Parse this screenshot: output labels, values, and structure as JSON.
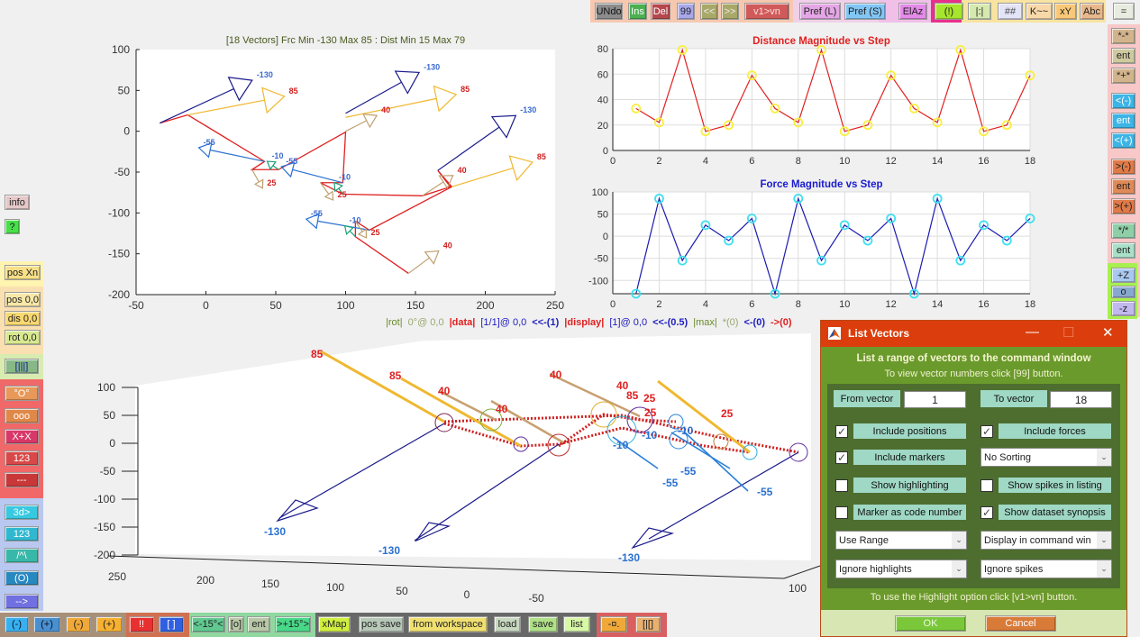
{
  "top_toolbar": {
    "buttons": [
      {
        "label": "UNdo",
        "bg": "#8c8c8c",
        "color": "#111"
      },
      {
        "label": "Ins",
        "bg": "#4caf50",
        "color": "#fff"
      },
      {
        "label": "Del",
        "bg": "#b5474d",
        "color": "#fff"
      },
      {
        "label": "99",
        "bg": "#a8a8e8",
        "color": "#223"
      },
      {
        "label": "<<",
        "bg": "#a8a868",
        "color": "#eee"
      },
      {
        "label": ">>",
        "bg": "#a8a868",
        "color": "#eee"
      },
      {
        "label": "v1>vn",
        "bg": "#d05a5a",
        "color": "#fdd"
      },
      {
        "label": "Pref (L)",
        "bg": "#e4a6e6",
        "color": "#222"
      },
      {
        "label": "Pref (S)",
        "bg": "#82c6f5",
        "color": "#222"
      },
      {
        "label": "ElAz",
        "bg": "#e48ae8",
        "color": "#222"
      },
      {
        "label": "(!)",
        "bg": "#a6e62c",
        "color": "#222"
      },
      {
        "label": "|:|",
        "bg": "#d6eab0",
        "color": "#222"
      },
      {
        "label": "##",
        "bg": "#e4e4f8",
        "color": "#444"
      },
      {
        "label": "K~~",
        "bg": "#f8d8a8",
        "color": "#222"
      },
      {
        "label": "xY",
        "bg": "#f8c878",
        "color": "#222"
      },
      {
        "label": "Abc",
        "bg": "#e8b88c",
        "color": "#222"
      },
      {
        "label": "=",
        "bg": "#e8ece0",
        "color": "#222"
      }
    ]
  },
  "right_toolbar": {
    "buttons": [
      {
        "label": "*-*",
        "bg": "#d2b48c"
      },
      {
        "label": "ent",
        "bg": "#cfc9a0"
      },
      {
        "label": "*+*",
        "bg": "#d2b48c"
      },
      {
        "label": "<(-)",
        "bg": "#3cb4e6"
      },
      {
        "label": "ent",
        "bg": "#3cb4e6"
      },
      {
        "label": "<(+)",
        "bg": "#3cb4e6"
      },
      {
        "label": ">(-)",
        "bg": "#e07a48"
      },
      {
        "label": "ent",
        "bg": "#e08a58"
      },
      {
        "label": ">(+)",
        "bg": "#e07a48"
      },
      {
        "label": "*/*",
        "bg": "#8fcfa8"
      },
      {
        "label": "ent",
        "bg": "#a8e0c8"
      },
      {
        "label": "+Z",
        "bg": "#a8c8f0"
      },
      {
        "label": "o",
        "bg": "#88a8d0"
      },
      {
        "label": "-z",
        "bg": "#c0b8ee"
      }
    ]
  },
  "left_toolbar": {
    "buttons": [
      {
        "label": "info",
        "bg": "#e6c8c8"
      },
      {
        "label": "?",
        "bg": "#48e048"
      },
      {
        "label": "pos Xn",
        "bg": "#f8e088"
      },
      {
        "label": "pos 0,0",
        "bg": "#f8e8a8"
      },
      {
        "label": "dis 0,0",
        "bg": "#f8d870"
      },
      {
        "label": "rot 0,0",
        "bg": "#d8e890"
      },
      {
        "label": "[|||]",
        "bg": "#88b888"
      },
      {
        "label": "°O°",
        "bg": "#e89858"
      },
      {
        "label": "ooo",
        "bg": "#e08848"
      },
      {
        "label": "X+X",
        "bg": "#d83868"
      },
      {
        "label": "123",
        "bg": "#d84848"
      },
      {
        "label": "---",
        "bg": "#c83838"
      },
      {
        "label": "3d>",
        "bg": "#38c8e0"
      },
      {
        "label": "123",
        "bg": "#30b8d0"
      },
      {
        "label": "/^\\",
        "bg": "#38b8a8"
      },
      {
        "label": "(O)",
        "bg": "#2888c0"
      },
      {
        "label": "-->",
        "bg": "#7070e0"
      }
    ]
  },
  "bottom_toolbar": {
    "buttons": [
      {
        "label": "(-)",
        "bg": "#38b0f0"
      },
      {
        "label": "(+)",
        "bg": "#4890d0"
      },
      {
        "label": "(-)",
        "bg": "#f0a838"
      },
      {
        "label": "(+)",
        "bg": "#f8b030"
      },
      {
        "label": "!!",
        "bg": "#e83030"
      },
      {
        "label": "[ ]",
        "bg": "#3060e0"
      },
      {
        "label": "<-15°<",
        "bg": "#60c890"
      },
      {
        "label": "[o]",
        "bg": "#b8c8a8"
      },
      {
        "label": "ent",
        "bg": "#b8c8a8"
      },
      {
        "label": ">+15°>",
        "bg": "#48d888"
      },
      {
        "label": "xMap",
        "bg": "#d0f040"
      },
      {
        "label": "pos save",
        "bg": "#b8c8b8"
      },
      {
        "label": "from workspace",
        "bg": "#f0e070"
      },
      {
        "label": "load",
        "bg": "#c8d8c0"
      },
      {
        "label": "save",
        "bg": "#b0e088"
      },
      {
        "label": "list",
        "bg": "#d8f8a8"
      },
      {
        "label": "-¤.",
        "bg": "#f0a838"
      },
      {
        "label": "[|[]",
        "bg": "#e8b070"
      }
    ]
  },
  "status_line": [
    {
      "text": "|rot|",
      "color": "#6a8a2a",
      "bold": false
    },
    {
      "text": "0°@ 0,0",
      "color": "#9aa870",
      "bold": false
    },
    {
      "text": "|data|",
      "color": "#e02020",
      "bold": true
    },
    {
      "text": "[1/1]@ 0,0",
      "color": "#2020c0",
      "bold": false
    },
    {
      "text": "<<-(1)",
      "color": "#2020c0",
      "bold": true
    },
    {
      "text": "|display|",
      "color": "#e02020",
      "bold": true
    },
    {
      "text": "[1]@ 0,0",
      "color": "#2020c0",
      "bold": false
    },
    {
      "text": "<<-(0.5)",
      "color": "#2020c0",
      "bold": true
    },
    {
      "text": "|max|",
      "color": "#6a8a2a",
      "bold": false
    },
    {
      "text": "*(0)",
      "color": "#9aa870",
      "bold": false
    },
    {
      "text": "<-(0)",
      "color": "#2020c0",
      "bold": true
    },
    {
      "text": "->(0)",
      "color": "#e02020",
      "bold": true
    }
  ],
  "chart_data": [
    {
      "type": "line",
      "title": "[18 Vectors] Frc Min -130 Max 85 : Dist Min 15 Max 79",
      "subtype": "2d-vector-path",
      "xlim": [
        -50,
        250
      ],
      "ylim": [
        -200,
        100
      ],
      "xticks": [
        -50,
        0,
        50,
        100,
        150,
        200,
        250
      ],
      "yticks": [
        -200,
        -150,
        -100,
        -50,
        0,
        50,
        100
      ],
      "path": [
        [
          -33,
          10
        ],
        [
          -13,
          20
        ],
        [
          42,
          -37
        ],
        [
          33,
          -47
        ],
        [
          52,
          -47
        ],
        [
          100,
          -1
        ],
        [
          98,
          -63
        ],
        [
          82,
          -63
        ],
        [
          98,
          -77
        ],
        [
          155,
          -79
        ],
        [
          175,
          -68
        ],
        [
          166,
          -48
        ],
        [
          176,
          -68
        ],
        [
          117,
          -121
        ],
        [
          107,
          -110
        ],
        [
          107,
          -129
        ],
        [
          145,
          -174
        ]
      ],
      "vectors": [
        {
          "from": [
            -33,
            10
          ],
          "tip": [
            20,
            52
          ],
          "label": "-130",
          "color": "#1a1a8a"
        },
        {
          "from": [
            -13,
            20
          ],
          "tip": [
            42,
            38
          ],
          "label": "85",
          "color": "#f0b830"
        },
        {
          "from": [
            42,
            -37
          ],
          "tip": [
            3,
            -23
          ],
          "label": "-55",
          "color": "#2a70d0"
        },
        {
          "from": [
            52,
            -47
          ],
          "tip": [
            48,
            -42
          ],
          "label": "-10",
          "color": "#18a078"
        },
        {
          "from": [
            33,
            -47
          ],
          "tip": [
            38,
            -62
          ],
          "label": "25",
          "color": "#c0a070"
        },
        {
          "from": [
            100,
            22
          ],
          "tip": [
            140,
            60
          ],
          "label": "-130",
          "color": "#1a1a8a"
        },
        {
          "from": [
            100,
            17
          ],
          "tip": [
            165,
            40
          ],
          "label": "85",
          "color": "#f0b830"
        },
        {
          "from": [
            100,
            0
          ],
          "tip": [
            115,
            13
          ],
          "label": "40",
          "color": "#c0a070"
        },
        {
          "from": [
            98,
            -63
          ],
          "tip": [
            62,
            -47
          ],
          "label": "-55",
          "color": "#2a70d0"
        },
        {
          "from": [
            98,
            -77
          ],
          "tip": [
            95,
            -70
          ],
          "label": "-10",
          "color": "#18a078"
        },
        {
          "from": [
            82,
            -63
          ],
          "tip": [
            88,
            -77
          ],
          "label": "25",
          "color": "#c0a070"
        },
        {
          "from": [
            166,
            -48
          ],
          "tip": [
            210,
            5
          ],
          "label": "-130",
          "color": "#1a1a8a"
        },
        {
          "from": [
            176,
            -68
          ],
          "tip": [
            220,
            -45
          ],
          "label": "85",
          "color": "#f0b830"
        },
        {
          "from": [
            155,
            -79
          ],
          "tip": [
            170,
            -62
          ],
          "label": "40",
          "color": "#c0a070"
        },
        {
          "from": [
            117,
            -121
          ],
          "tip": [
            80,
            -110
          ],
          "label": "-55",
          "color": "#2a70d0"
        },
        {
          "from": [
            107,
            -129
          ],
          "tip": [
            103,
            -122
          ],
          "label": "-10",
          "color": "#18a078"
        },
        {
          "from": [
            107,
            -110
          ],
          "tip": [
            112,
            -123
          ],
          "label": "25",
          "color": "#c0a070"
        },
        {
          "from": [
            145,
            -174
          ],
          "tip": [
            160,
            -155
          ],
          "label": "40",
          "color": "#c0a070"
        }
      ]
    },
    {
      "type": "line",
      "title": "Distance Magnitude vs Step",
      "x": [
        1,
        2,
        3,
        4,
        5,
        6,
        7,
        8,
        9,
        10,
        11,
        12,
        13,
        14,
        15,
        16,
        17,
        18
      ],
      "series": [
        {
          "name": "Distance",
          "values": [
            33,
            22,
            79,
            15,
            20,
            59,
            33,
            22,
            79,
            15,
            20,
            59,
            33,
            22,
            79,
            15,
            20,
            59
          ],
          "color": "#e02020",
          "marker_color": "#f8f040"
        }
      ],
      "xlim": [
        0,
        18
      ],
      "ylim": [
        0,
        80
      ],
      "xticks": [
        0,
        2,
        4,
        6,
        8,
        10,
        12,
        14,
        16,
        18
      ],
      "yticks": [
        0,
        20,
        40,
        60,
        80
      ],
      "grid": true,
      "title_color": "#e02020"
    },
    {
      "type": "line",
      "title": "Force Magnitude vs Step",
      "x": [
        1,
        2,
        3,
        4,
        5,
        6,
        7,
        8,
        9,
        10,
        11,
        12,
        13,
        14,
        15,
        16,
        17,
        18
      ],
      "series": [
        {
          "name": "Force",
          "values": [
            -130,
            85,
            -55,
            25,
            -10,
            40,
            -130,
            85,
            -55,
            25,
            -10,
            40,
            -130,
            85,
            -55,
            25,
            -10,
            40
          ],
          "color": "#1a1ab0",
          "marker_color": "#40e0f0"
        }
      ],
      "xlim": [
        0,
        18
      ],
      "ylim": [
        -130,
        100
      ],
      "xticks": [
        0,
        2,
        4,
        6,
        8,
        10,
        12,
        14,
        16,
        18
      ],
      "yticks": [
        -100,
        -50,
        0,
        50,
        100
      ],
      "grid": true,
      "title_color": "#1a1ad0"
    },
    {
      "type": "line",
      "subtype": "3d-vector-view",
      "zticks": [
        -200,
        -150,
        -100,
        -50,
        0,
        50,
        100
      ],
      "xticks": [
        250,
        200,
        150,
        100,
        50,
        0,
        -50
      ],
      "yticks": [
        100
      ],
      "labels": [
        {
          "text": "85",
          "color": "#e02020"
        },
        {
          "text": "85",
          "color": "#e02020"
        },
        {
          "text": "40",
          "color": "#e02020"
        },
        {
          "text": "40",
          "color": "#e02020"
        },
        {
          "text": "40",
          "color": "#e02020"
        },
        {
          "text": "40",
          "color": "#e02020"
        },
        {
          "text": "85",
          "color": "#e02020"
        },
        {
          "text": "25",
          "color": "#e02020"
        },
        {
          "text": "25",
          "color": "#e02020"
        },
        {
          "text": "25",
          "color": "#e02020"
        },
        {
          "text": "-10",
          "color": "#2a70d0"
        },
        {
          "text": "-10",
          "color": "#2a70d0"
        },
        {
          "text": "-10",
          "color": "#2a70d0"
        },
        {
          "text": "-55",
          "color": "#2a70d0"
        },
        {
          "text": "-55",
          "color": "#2a70d0"
        },
        {
          "text": "-55",
          "color": "#2a70d0"
        },
        {
          "text": "-130",
          "color": "#2a70d0"
        },
        {
          "text": "-130",
          "color": "#2a70d0"
        },
        {
          "text": "-130",
          "color": "#2a70d0"
        }
      ]
    }
  ],
  "dialog": {
    "title": "List Vectors",
    "heading": "List a range of vectors to the command window",
    "subheading": "To view vector numbers click  [99]  button.",
    "from_label": "From vector",
    "from_value": "1",
    "to_label": "To vector",
    "to_value": "18",
    "checkboxes": [
      {
        "label": "Include positions",
        "checked": true
      },
      {
        "label": "Include forces",
        "checked": true
      },
      {
        "label": "Include markers",
        "checked": true
      },
      {
        "label": "Show highlighting",
        "checked": false
      },
      {
        "label": "Show spikes in listing",
        "checked": false
      },
      {
        "label": "Marker as code number",
        "checked": false
      },
      {
        "label": "Show dataset synopsis",
        "checked": true
      }
    ],
    "sorting_select": "No Sorting",
    "range_select": "Use Range",
    "display_select": "Display in command win",
    "highlights_select": "Ignore highlights",
    "spikes_select": "Ignore spikes",
    "footer_note": "To use the Highlight option click  [v1>vn]  button.",
    "ok_label": "OK",
    "cancel_label": "Cancel",
    "minimize_glyph": "—",
    "maximize_glyph": "☐",
    "close_glyph": "✕",
    "check_glyph": "✓"
  }
}
